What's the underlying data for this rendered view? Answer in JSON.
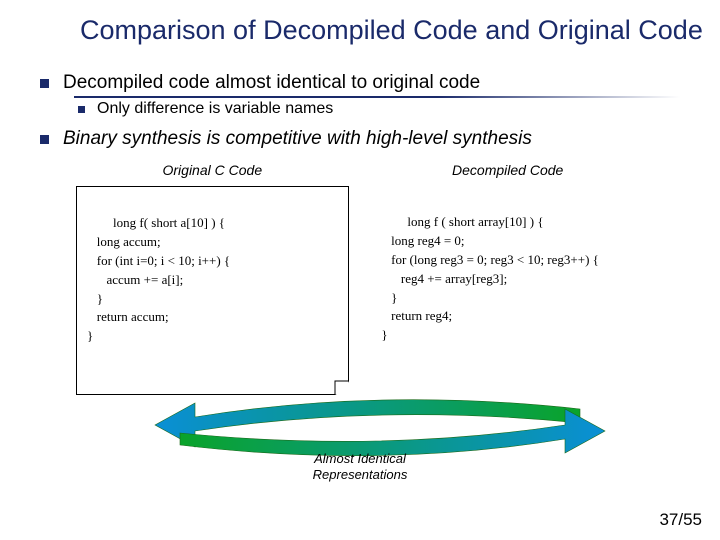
{
  "title": "Comparison of Decompiled Code and Original Code",
  "bullets": {
    "main1": "Decompiled code almost identical to original code",
    "sub1": "Only difference is variable names",
    "main2": "Binary synthesis is competitive with high-level synthesis"
  },
  "columns": {
    "left": {
      "title": "Original C Code",
      "code": "long f( short a[10] ) {\n   long accum;\n   for (int i=0; i < 10; i++) {\n      accum += a[i];\n   }\n   return accum;\n}"
    },
    "right": {
      "title": "Decompiled Code",
      "code": "long f ( short array[10] ) {\n   long reg4 = 0;\n   for (long reg3 = 0; reg3 < 10; reg3++) {\n      reg4 += array[reg3];\n   }\n   return reg4;\n}"
    }
  },
  "caption": "Almost Identical\nRepresentations",
  "page": "37/55"
}
